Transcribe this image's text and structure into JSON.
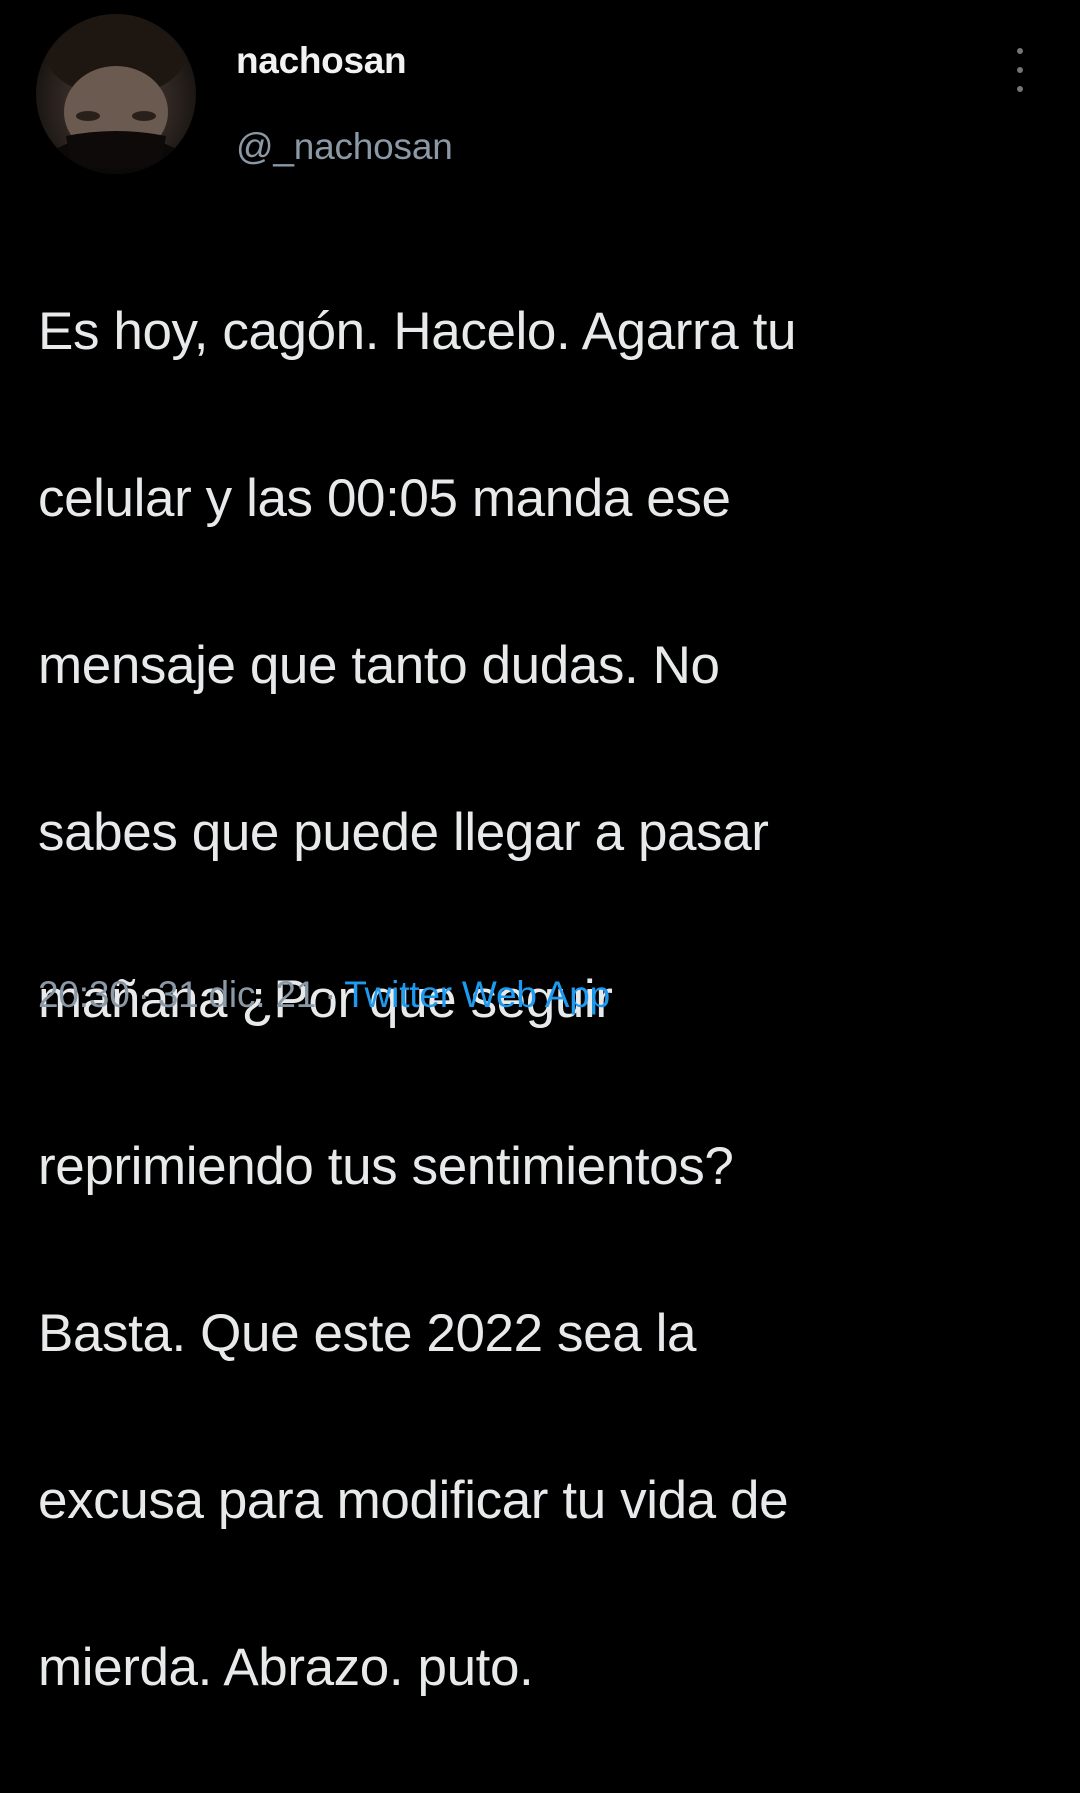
{
  "author": {
    "display_name": "nachosan",
    "handle": "@_nachosan"
  },
  "tweet": {
    "text_lines": [
      "Es hoy, cagón. Hacelo. Agarra tu",
      "celular y las 00:05 manda ese",
      "mensaje que tanto dudas. No",
      "sabes que puede llegar a pasar",
      "mañana ¿Por que seguir",
      "reprimiendo tus sentimientos?",
      "Basta. Que este 2022 sea la",
      "excusa para modificar tu vida de",
      "mierda. Abrazo. puto."
    ]
  },
  "meta": {
    "time": "20:30",
    "separator": "·",
    "date": "31 dic. 21",
    "source": "Twitter Web App"
  },
  "icons": {
    "more": "more-vertical-icon"
  },
  "colors": {
    "background": "#000000",
    "text": "#e7e9ea",
    "secondary": "#8b98a5",
    "link": "#1d9bf0"
  }
}
